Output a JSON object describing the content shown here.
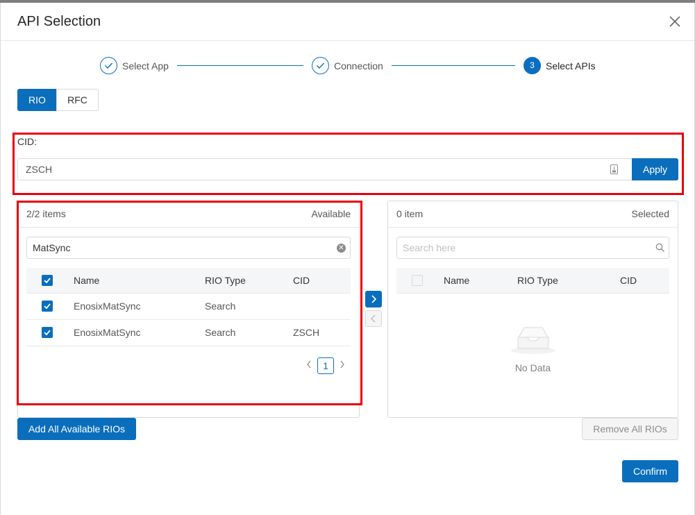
{
  "dialog": {
    "title": "API Selection"
  },
  "steps": [
    {
      "label": "Select App",
      "state": "done"
    },
    {
      "label": "Connection",
      "state": "done"
    },
    {
      "label": "Select APIs",
      "state": "active",
      "number": "3"
    }
  ],
  "tabs": [
    {
      "label": "RIO",
      "selected": true
    },
    {
      "label": "RFC",
      "selected": false
    }
  ],
  "cid": {
    "label": "CID",
    "separator": ":",
    "value": "ZSCH",
    "apply_label": "Apply"
  },
  "available": {
    "count_label": "2/2 items",
    "title": "Available",
    "search_value": "MatSync",
    "columns": [
      "Name",
      "RIO Type",
      "CID"
    ],
    "rows": [
      {
        "name": "EnosixMatSync",
        "type": "Search",
        "cid": "",
        "checked": true
      },
      {
        "name": "EnosixMatSync",
        "type": "Search",
        "cid": "ZSCH",
        "checked": true
      }
    ],
    "page": "1"
  },
  "selected": {
    "count_label": "0 item",
    "title": "Selected",
    "search_placeholder": "Search here",
    "columns": [
      "Name",
      "RIO Type",
      "CID"
    ],
    "empty_text": "No Data"
  },
  "buttons": {
    "add_all": "Add All Available RIOs",
    "remove_all": "Remove All RIOs",
    "confirm": "Confirm"
  },
  "colors": {
    "primary": "#0a6ebd",
    "highlight": "#e8000b"
  }
}
